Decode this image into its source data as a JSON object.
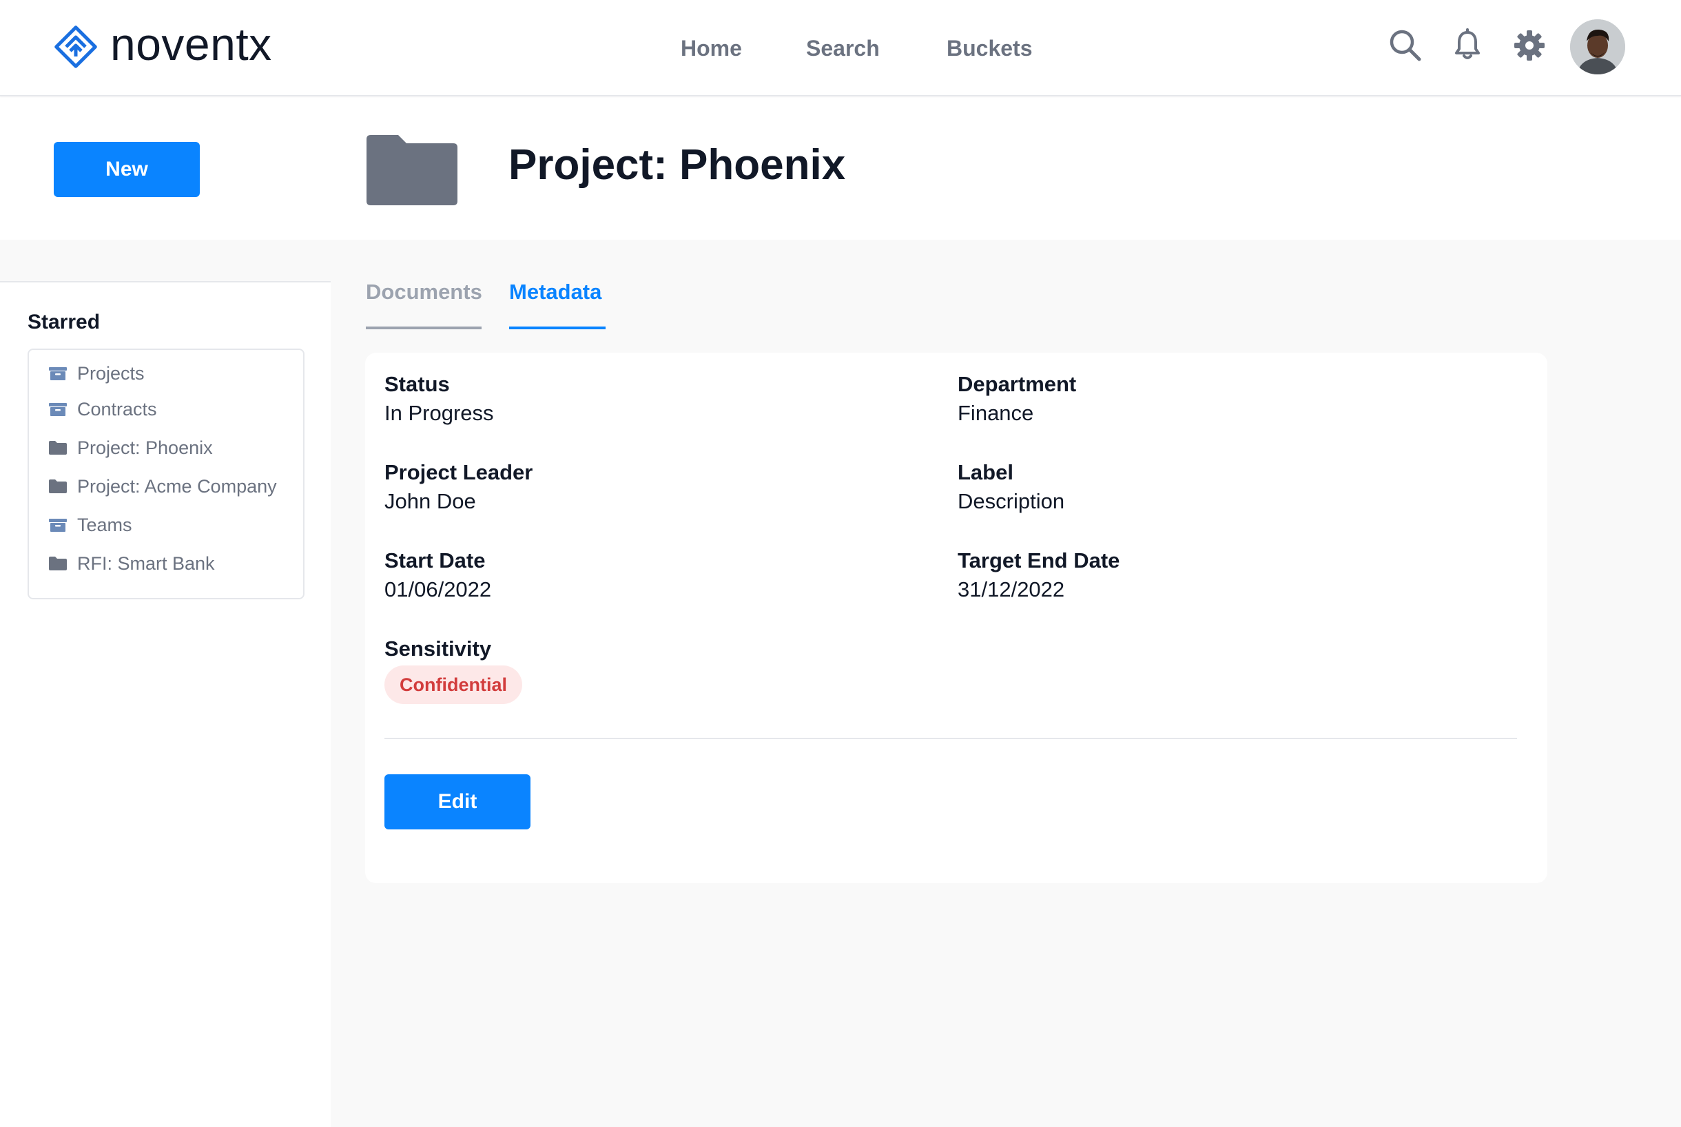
{
  "header": {
    "logo_text": "noventx",
    "nav": {
      "home": "Home",
      "search": "Search",
      "buckets": "Buckets"
    },
    "icons": [
      "search-icon",
      "bell-icon",
      "gear-icon",
      "avatar"
    ]
  },
  "project": {
    "new_label": "New",
    "title": "Project: Phoenix",
    "icon": "folder-icon"
  },
  "sidebar": {
    "title": "Starred",
    "items": [
      {
        "label": "Projects",
        "icon": "archive-box-icon"
      },
      {
        "label": "Contracts",
        "icon": "archive-box-icon"
      },
      {
        "label": "Project: Phoenix",
        "icon": "folder-icon"
      },
      {
        "label": "Project: Acme Company",
        "icon": "folder-icon"
      },
      {
        "label": "Teams",
        "icon": "archive-box-icon"
      },
      {
        "label": "RFI: Smart Bank",
        "icon": "folder-icon"
      }
    ]
  },
  "tabs": {
    "documents": "Documents",
    "metadata": "Metadata",
    "active": "Metadata"
  },
  "metadata": {
    "status": {
      "label": "Status",
      "value": "In Progress"
    },
    "department": {
      "label": "Department",
      "value": "Finance"
    },
    "project_leader": {
      "label": "Project Leader",
      "value": "John Doe"
    },
    "label": {
      "label": "Label",
      "value": "Description"
    },
    "start_date": {
      "label": "Start Date",
      "value": "01/06/2022"
    },
    "target_end_date": {
      "label": "Target End Date",
      "value": "31/12/2022"
    },
    "sensitivity": {
      "label": "Sensitivity",
      "value": "Confidential"
    },
    "edit_label": "Edit"
  },
  "colors": {
    "primary": "#0a84ff",
    "text": "#111827",
    "muted": "#6b7280",
    "icon_gray": "#6b7280",
    "badge_bg": "#fde8e8",
    "badge_text": "#d23c3c",
    "page_bg": "#f9f9f9"
  }
}
